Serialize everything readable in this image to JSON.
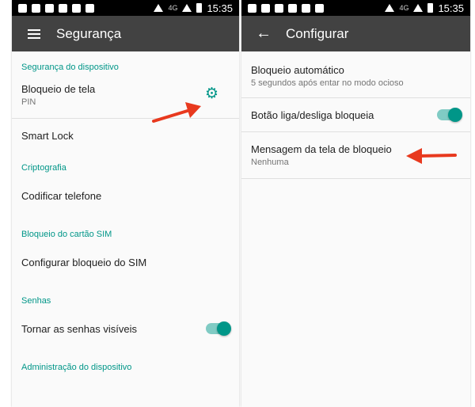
{
  "status_bar": {
    "time_left": "15:35",
    "time_right": "15:35",
    "network": "4G"
  },
  "left": {
    "title": "Segurança",
    "sections": {
      "device_security": "Segurança do dispositivo",
      "cryptography": "Criptografia",
      "sim_lock": "Bloqueio do cartão SIM",
      "passwords": "Senhas",
      "device_admin": "Administração do dispositivo"
    },
    "items": {
      "screen_lock": {
        "label": "Bloqueio de tela",
        "value": "PIN"
      },
      "smart_lock": "Smart Lock",
      "encrypt_phone": "Codificar telefone",
      "configure_sim": "Configurar bloqueio do SIM",
      "show_passwords": "Tornar as senhas visíveis"
    },
    "show_passwords_enabled": true
  },
  "right": {
    "title": "Configurar",
    "items": {
      "auto_lock": {
        "label": "Bloqueio automático",
        "value": "5 segundos após entar no modo ocioso"
      },
      "power_button": "Botão liga/desliga bloqueia",
      "lock_message": {
        "label": "Mensagem da tela de bloqueio",
        "value": "Nenhuma"
      }
    },
    "power_button_enabled": true
  },
  "colors": {
    "accent": "#009688",
    "appbar": "#424242",
    "annotation_arrow": "#e8391e"
  },
  "icons": {
    "menu": "hamburger-icon",
    "back": "back-arrow-icon",
    "settings": "gear-icon"
  }
}
